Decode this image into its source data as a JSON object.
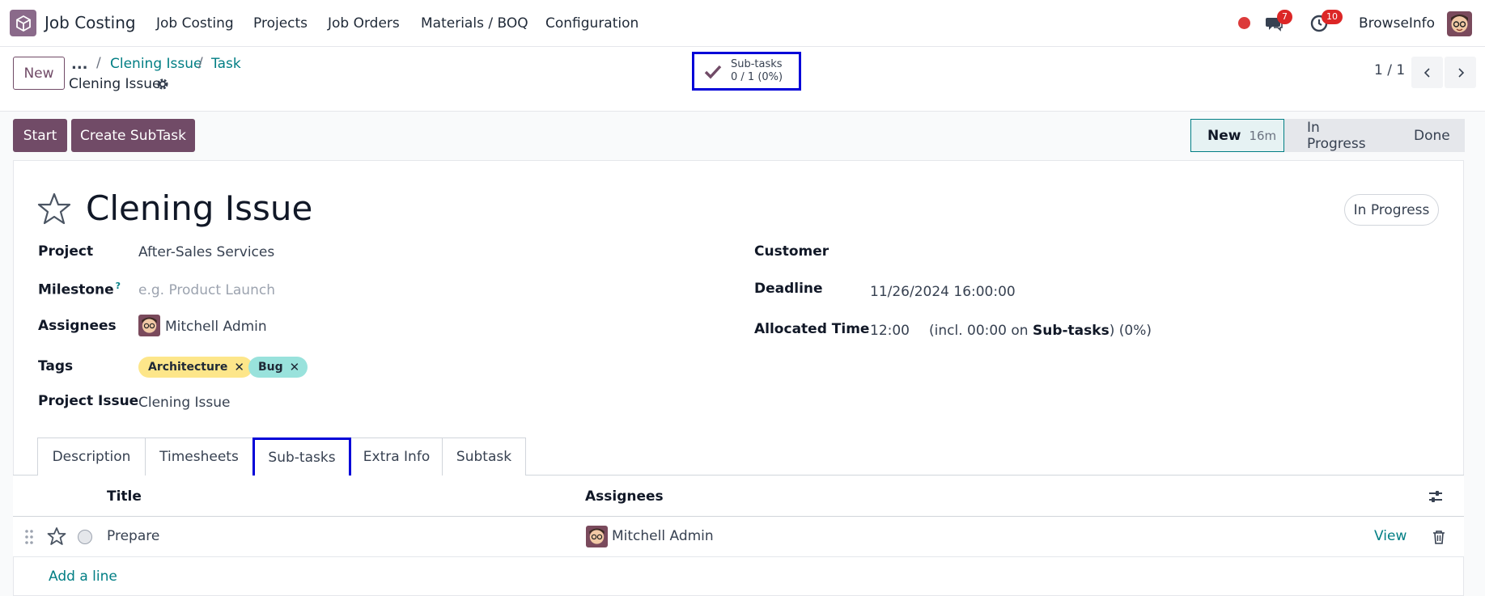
{
  "navbar": {
    "app_name": "Job Costing",
    "menu": [
      "Job Costing",
      "Projects",
      "Job Orders",
      "Materials / BOQ",
      "Configuration"
    ],
    "chat_count": "7",
    "activity_count": "10",
    "user_name": "BrowseInfo",
    "icons": [
      "app-logo-icon",
      "status-dot-icon",
      "chat-icon",
      "clock-icon",
      "avatar"
    ]
  },
  "control_panel": {
    "new_label": "New",
    "breadcrumb_more": "...",
    "breadcrumbs": [
      "Clening Issue",
      "Task"
    ],
    "current_record": "Clening Issue",
    "smart_button": {
      "label": "Sub-tasks",
      "value": "0 / 1 (0%)"
    },
    "pager": "1 / 1"
  },
  "status_bar": {
    "start_label": "Start",
    "create_subtask_label": "Create SubTask",
    "stages": [
      {
        "name": "New",
        "duration": "16m",
        "active": true
      },
      {
        "name": "In Progress",
        "active": false
      },
      {
        "name": "Done",
        "active": false
      }
    ]
  },
  "form": {
    "title": "Clening Issue",
    "state_badge": "In Progress",
    "project_label": "Project",
    "project_value": "After-Sales Services",
    "milestone_label": "Milestone",
    "milestone_help": "?",
    "milestone_placeholder": "e.g. Product Launch",
    "assignees_label": "Assignees",
    "assignees_value": "Mitchell Admin",
    "tags_label": "Tags",
    "tags": [
      {
        "name": "Architecture",
        "color": "#fde68a"
      },
      {
        "name": "Bug",
        "color": "#99e2dc"
      }
    ],
    "project_issue_label": "Project Issue",
    "project_issue_value": "Clening Issue",
    "customer_label": "Customer",
    "customer_value": "",
    "deadline_label": "Deadline",
    "deadline_value": "11/26/2024 16:00:00",
    "allocated_label": "Allocated Time",
    "allocated_value": "12:00",
    "allocated_note_prefix": "(incl. 00:00 on ",
    "allocated_note_bold": "Sub-tasks",
    "allocated_note_suffix": ") (0%)"
  },
  "tabs": [
    {
      "label": "Description",
      "active": false
    },
    {
      "label": "Timesheets",
      "active": false
    },
    {
      "label": "Sub-tasks",
      "active": true
    },
    {
      "label": "Extra Info",
      "active": false
    },
    {
      "label": "Subtask",
      "active": false
    }
  ],
  "subtasks": {
    "columns": [
      "Title",
      "Assignees"
    ],
    "rows": [
      {
        "title": "Prepare",
        "assignee": "Mitchell Admin",
        "action": "View"
      }
    ],
    "add_line": "Add a line"
  },
  "colors": {
    "brand": "#714b67",
    "link": "#017e84",
    "highlight": "#0000d8",
    "badge": "#dc2626"
  }
}
